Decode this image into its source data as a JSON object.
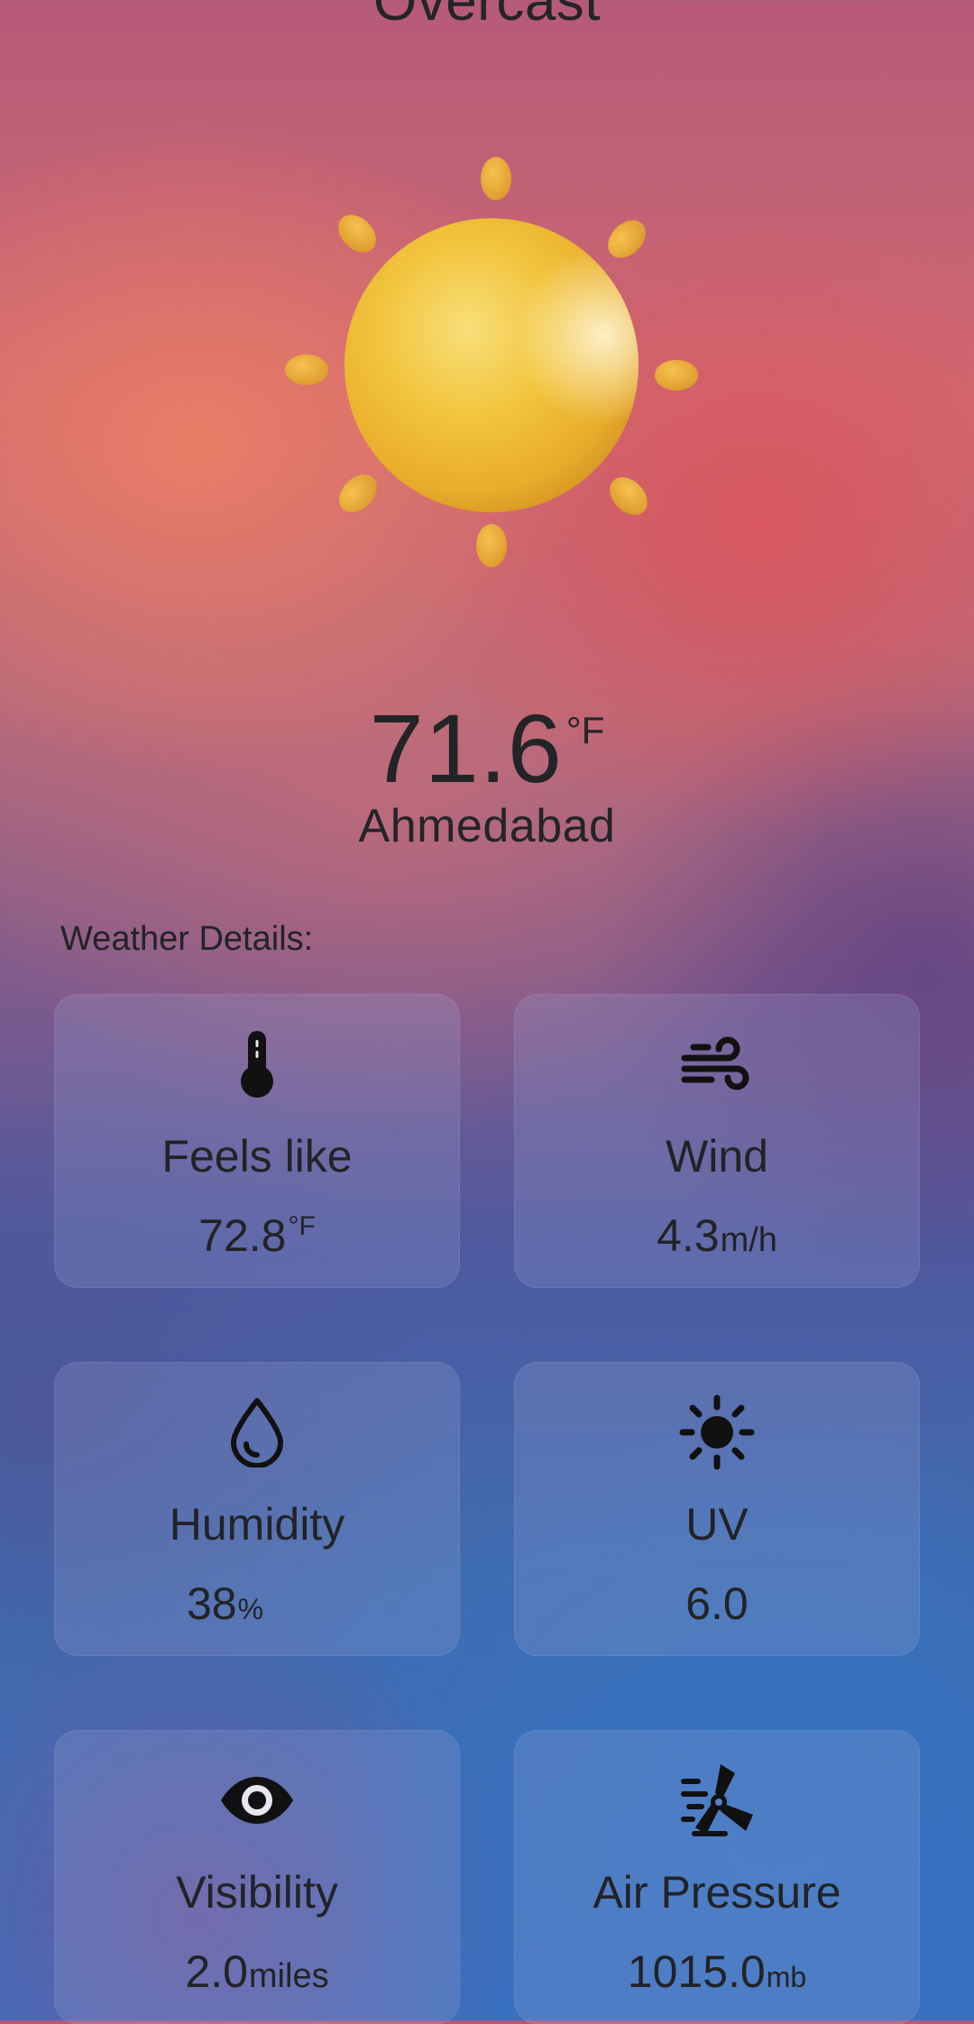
{
  "header": {
    "condition": "Overcast"
  },
  "hero": {
    "icon": "sun-icon",
    "sun_color": "#f2c53e",
    "ray_color": "#e9a93a"
  },
  "current": {
    "temperature": "71.6",
    "temperature_unit": "°F",
    "city": "Ahmedabad"
  },
  "details": {
    "section_label": "Weather Details:",
    "cards": [
      {
        "icon": "thermometer-icon",
        "label": "Feels like",
        "value": "72.8",
        "unit": "°F"
      },
      {
        "icon": "wind-icon",
        "label": "Wind",
        "value": "4.3",
        "unit": "m/h"
      },
      {
        "icon": "water-drop-icon",
        "label": "Humidity",
        "value": "38",
        "unit": "%"
      },
      {
        "icon": "sun-icon",
        "label": "UV",
        "value": "6.0",
        "unit": ""
      },
      {
        "icon": "eye-icon",
        "label": "Visibility",
        "value": "2.0",
        "unit": "miles"
      },
      {
        "icon": "air-pressure-icon",
        "label": "Air Pressure",
        "value": "1015.0",
        "unit": "mb"
      }
    ]
  }
}
